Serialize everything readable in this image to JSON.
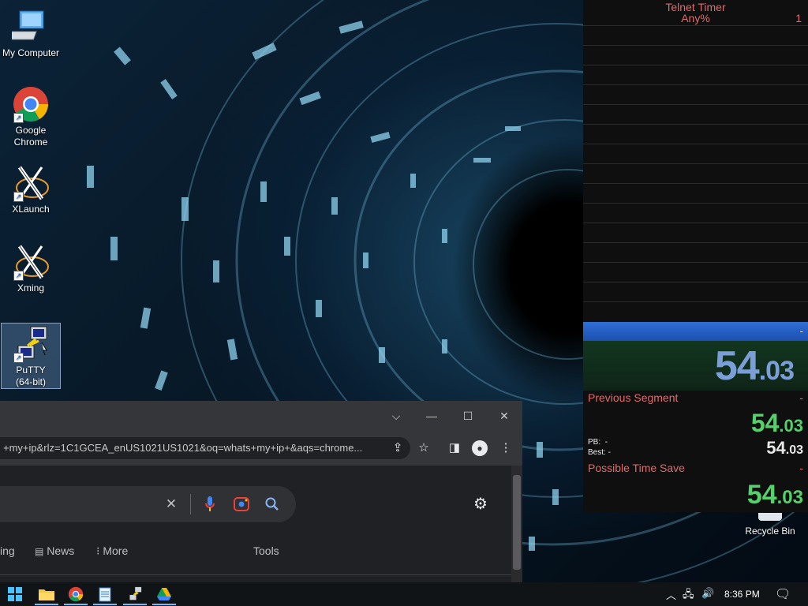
{
  "desktop": {
    "icons": [
      {
        "label": "My Computer"
      },
      {
        "label": "Google\nChrome"
      },
      {
        "label": "XLaunch"
      },
      {
        "label": "Xming"
      },
      {
        "label": "PuTTY\n(64-bit)"
      }
    ],
    "recycle_bin": "Recycle Bin"
  },
  "timer": {
    "title": "Telnet Timer",
    "category": "Any%",
    "attempts": "1",
    "current_split_delta": "-",
    "main_time_whole": "54",
    "main_time_decimal": ".03",
    "previous_segment_label": "Previous Segment",
    "previous_segment_value": "-",
    "segment_time_whole": "54",
    "segment_time_decimal": ".03",
    "pb_label": "PB:",
    "pb_value": "-",
    "best_label": "Best:",
    "best_value": "-",
    "best_time_whole": "54",
    "best_time_decimal": ".03",
    "possible_time_save_label": "Possible Time Save",
    "possible_time_save_value": "-",
    "pts_time_whole": "54",
    "pts_time_decimal": ".03"
  },
  "chrome": {
    "url": "+my+ip&rlz=1C1GCEA_enUS1021US1021&oq=whats+my+ip+&aqs=chrome...",
    "tabs": [
      "ing",
      "News",
      "More",
      "Tools"
    ]
  },
  "taskbar": {
    "clock": "8:36 PM"
  },
  "colors": {
    "timer_red": "#e06b6b",
    "timer_green": "#55d16b",
    "timer_blue": "#7a9fd6",
    "current_split_blue": "#2f6fd6"
  }
}
